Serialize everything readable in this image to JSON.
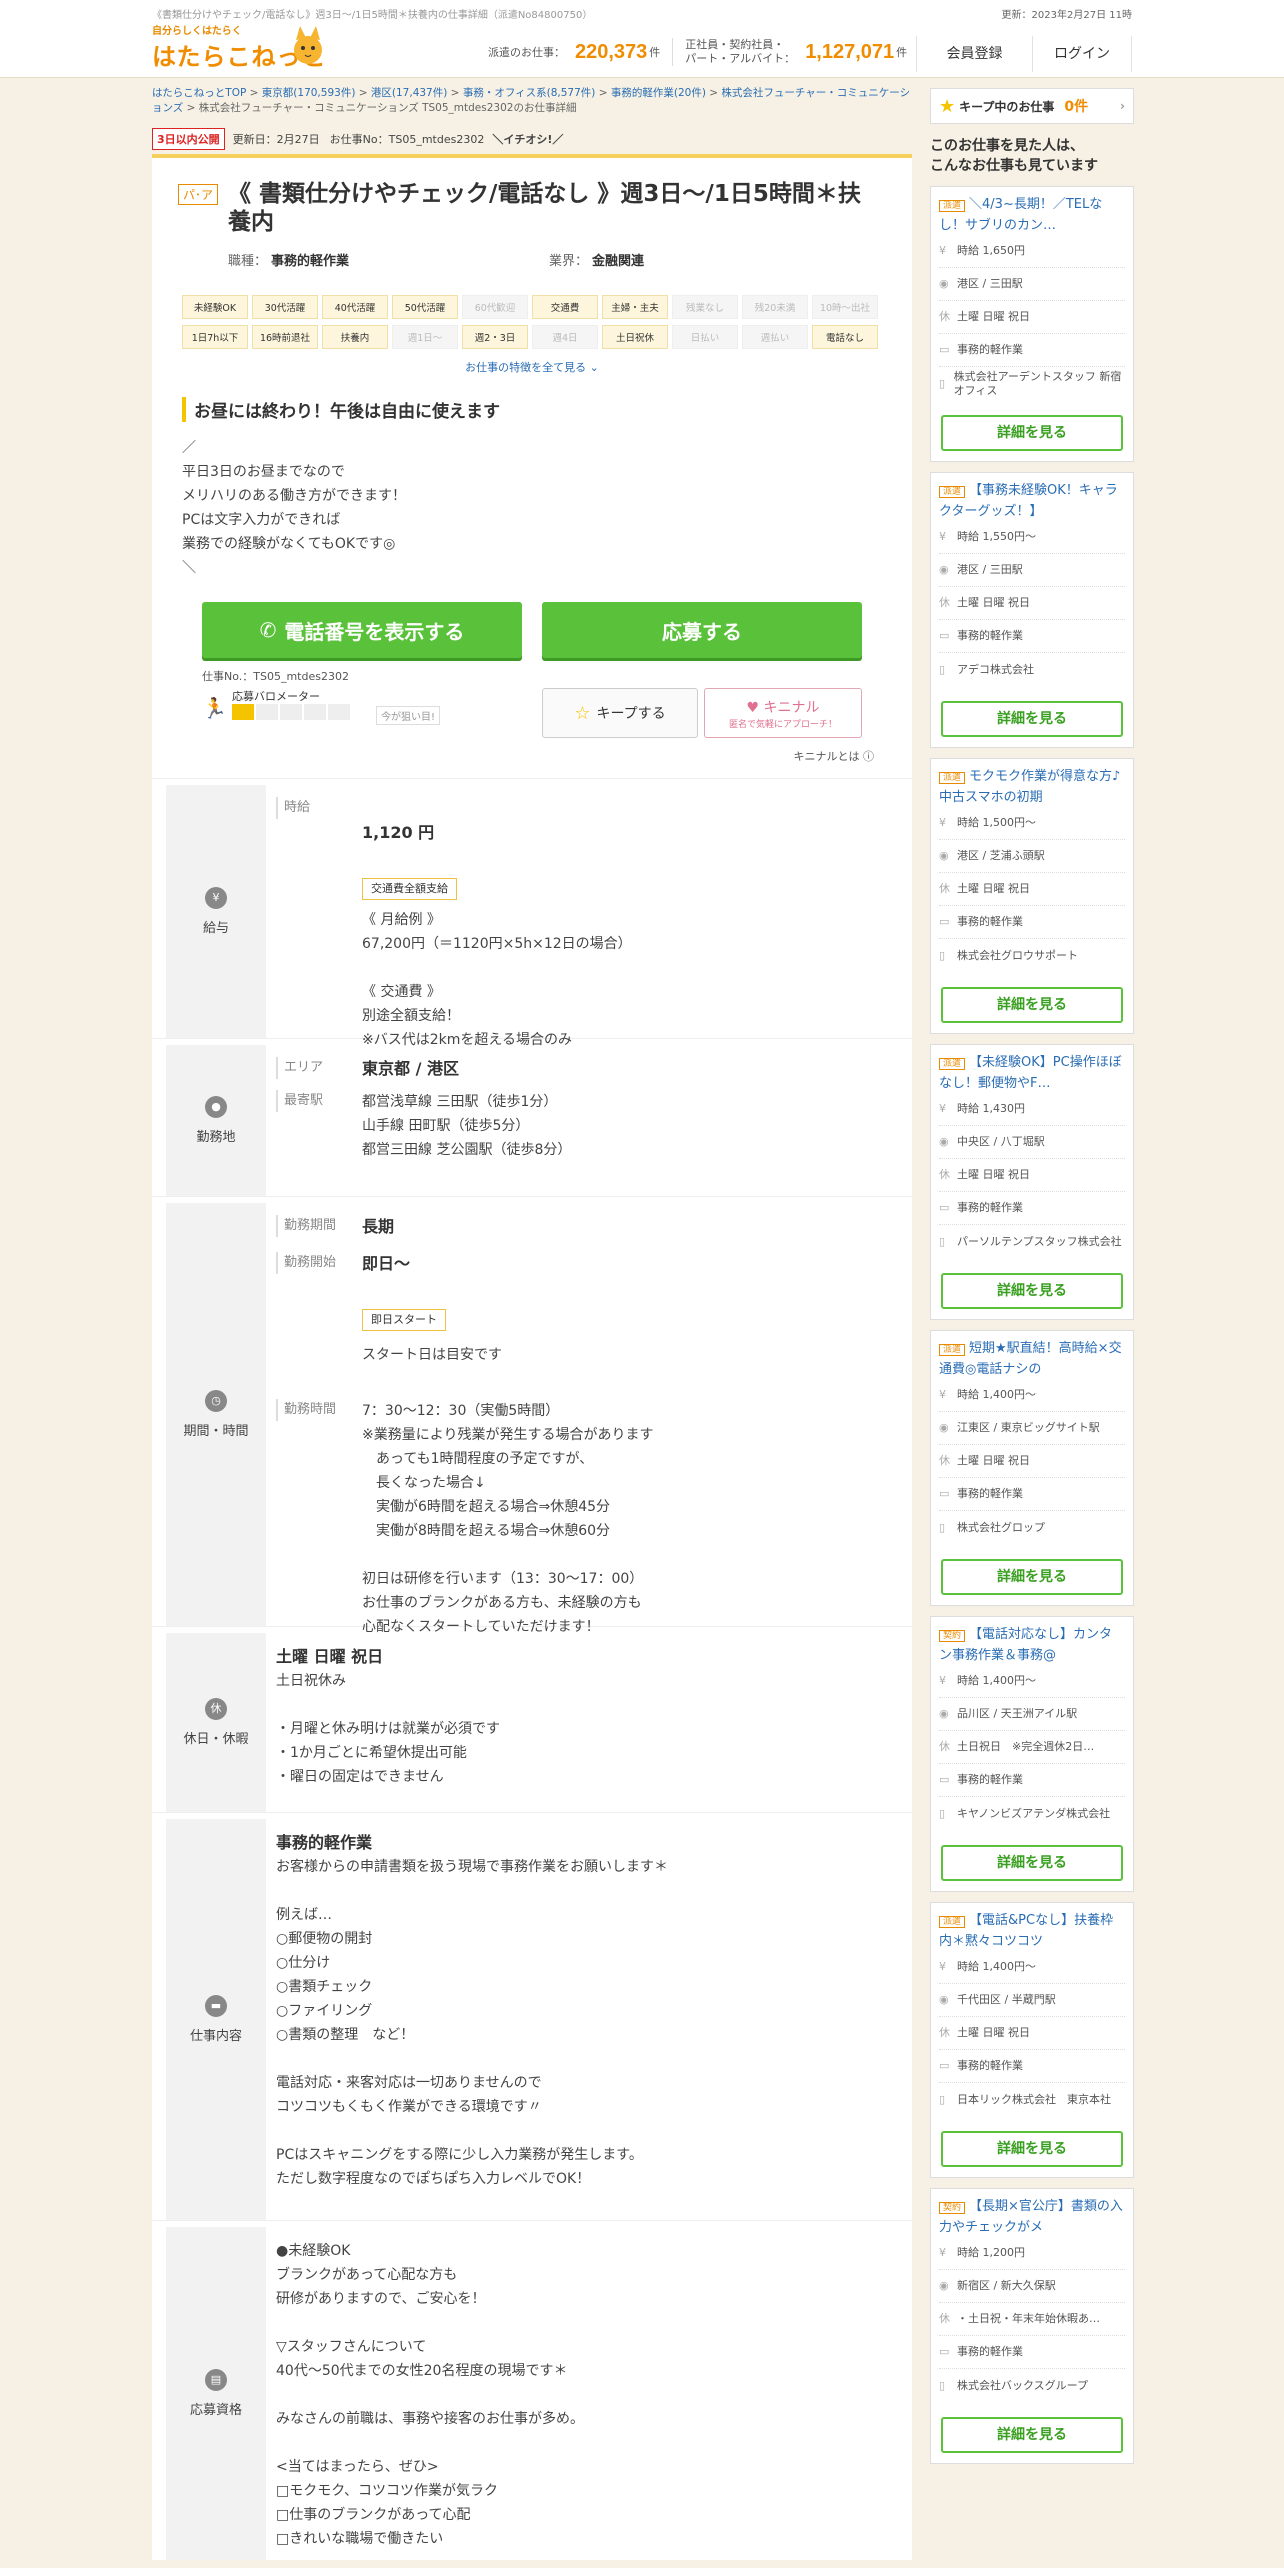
{
  "header": {
    "breadcrumb_top": "《書類仕分けやチェック/電話なし》週3日～/1日5時間＊扶養内の仕事詳細（派遣No84800750）",
    "updated": "更新：2023年2月27日 11時",
    "logo_small": "自分らしくはたらく",
    "logo_main": "はたらこねっと",
    "count1_label": "派遣のお仕事：",
    "count1_value": "220,373",
    "count1_unit": "件",
    "count2_label1": "正社員・契約社員・",
    "count2_label2": "パート・アルバイト：",
    "count2_value": "1,127,071",
    "count2_unit": "件",
    "register": "会員登録",
    "login": "ログイン"
  },
  "breadcrumb": [
    "はたらこねっとTOP",
    "東京都(170,593件)",
    "港区(17,437件)",
    "事務・オフィス系(8,577件)",
    "事務的軽作業(20件)",
    "株式会社フューチャー・コミュニケーションズ"
  ],
  "breadcrumb_last": "株式会社フューチャー・コミュニケーションズ TS05_mtdes2302のお仕事詳細",
  "job": {
    "new_badge": "3日以内公開",
    "updated": "更新日：2月27日",
    "job_no_label": "お仕事No：TS05_mtdes2302",
    "ichioshi": "＼イチオシ!／",
    "type_badge": "パ･ア",
    "title": "《 書類仕分けやチェック/電話なし 》週3日～/1日5時間＊扶養内",
    "occupation_key": "職種：",
    "occupation": "事務的軽作業",
    "industry_key": "業界：",
    "industry": "金融関連",
    "tags_row1": [
      {
        "t": "未経験OK",
        "on": true
      },
      {
        "t": "30代活躍",
        "on": true
      },
      {
        "t": "40代活躍",
        "on": true
      },
      {
        "t": "50代活躍",
        "on": true
      },
      {
        "t": "60代歓迎",
        "on": false
      },
      {
        "t": "交通費",
        "on": true
      },
      {
        "t": "主婦・主夫",
        "on": true
      },
      {
        "t": "残業なし",
        "on": false
      },
      {
        "t": "残20未満",
        "on": false
      },
      {
        "t": "10時～出社",
        "on": false
      }
    ],
    "tags_row2": [
      {
        "t": "1日7h以下",
        "on": true
      },
      {
        "t": "16時前退社",
        "on": true
      },
      {
        "t": "扶養内",
        "on": true
      },
      {
        "t": "週1日～",
        "on": false
      },
      {
        "t": "週2・3日",
        "on": true
      },
      {
        "t": "週4日",
        "on": false
      },
      {
        "t": "土日祝休",
        "on": true
      },
      {
        "t": "日払い",
        "on": false
      },
      {
        "t": "週払い",
        "on": false
      },
      {
        "t": "電話なし",
        "on": true
      }
    ],
    "more_features": "お仕事の特徴を全て見る",
    "catch": "お昼には終わり！午後は自由に使えます",
    "pr": "／\n平日3日のお昼までなので\nメリハリのある働き方ができます！\nPCは文字入力ができれば\n業務での経験がなくてもOKです◎\n＼",
    "phone_btn": "電話番号を表示する",
    "apply_btn": "応募する",
    "job_no": "仕事No.：TS05_mtdes2302",
    "barometer_label": "応募バロメーター",
    "barometer_hint": "今が狙い目!",
    "barometer_level": 1,
    "keep_btn": "キープする",
    "kinichi_btn": "キニナル",
    "kinichi_sub": "匿名で気軽にアプローチ！",
    "kinichi_about": "キニナルとは"
  },
  "salary": {
    "head": "給与",
    "type": "時給",
    "amount": "1,120 円",
    "chip": "交通費全額支給",
    "detail": "《 月給例 》\n67,200円（＝1120円×5h×12日の場合）\n\n《 交通費 》\n別途全額支給！\n※バス代は2kmを超える場合のみ"
  },
  "location": {
    "head": "勤務地",
    "area_label": "エリア",
    "area": "東京都 / 港区",
    "station_label": "最寄駅",
    "stations": "都営浅草線 三田駅（徒歩1分）\n山手線 田町駅（徒歩5分）\n都営三田線 芝公園駅（徒歩8分）"
  },
  "period": {
    "head": "期間・時間",
    "period_label": "勤務期間",
    "period": "長期",
    "start_label": "勤務開始",
    "start": "即日～",
    "start_chip": "即日スタート",
    "start_note": "スタート日は目安です",
    "time_label": "勤務時間",
    "time": "7：30～12：30（実働5時間）\n※業務量により残業が発生する場合があります\n　あっても1時間程度の予定ですが、\n　長くなった場合↓\n　実働が6時間を超える場合⇒休憩45分\n　実働が8時間を超える場合⇒休憩60分\n\n初日は研修を行います（13：30～17：00）\nお仕事のブランクがある方も、未経験の方も\n心配なくスタートしていただけます！"
  },
  "holiday": {
    "head": "休日・休暇",
    "title": "土曜 日曜 祝日",
    "detail": "土日祝休み\n\n・月曜と休み明けは就業が必須です\n・1か月ごとに希望休提出可能\n・曜日の固定はできません"
  },
  "work": {
    "head": "仕事内容",
    "title": "事務的軽作業",
    "detail": "お客様からの申請書類を扱う現場で事務作業をお願いします＊\n\n例えば…\n○郵便物の開封\n○仕分け\n○書類チェック\n○ファイリング\n○書類の整理　など！\n\n電話対応・来客対応は一切ありませんので\nコツコツもくもく作業ができる環境です〃\n\nPCはスキャニングをする際に少し入力業務が発生します。\nただし数字程度なのでぽちぽち入力レベルでOK！"
  },
  "qual": {
    "head": "応募資格",
    "detail": "●未経験OK\nブランクがあって心配な方も\n研修がありますので、ご安心を！\n\n▽スタッフさんについて\n40代～50代までの女性20名程度の現場です＊\n\nみなさんの前職は、事務や接客のお仕事が多め。\n\n<当てはまったら、ぜひ>\n□モクモク、コツコツ作業が気ラク\n□仕事のブランクがあって心配\n□きれいな職場で働きたい"
  },
  "sidebar": {
    "kept_label": "キープ中のお仕事",
    "kept_count": "0件",
    "heading": "このお仕事を見た人は、\nこんなお仕事も見ています",
    "detail_btn": "詳細を見る",
    "cards": [
      {
        "badge": "派遣",
        "title": "＼4/3~長期！／TELなし！サブリのカン…",
        "wage": "時給 1,650円",
        "area": "港区 / 三田駅",
        "holiday": "土曜 日曜 祝日",
        "job": "事務的軽作業",
        "company": "株式会社アーデントスタッフ 新宿オフィス"
      },
      {
        "badge": "派遣",
        "title": "【事務未経験OK！キャラクターグッズ！】",
        "wage": "時給 1,550円～",
        "area": "港区 / 三田駅",
        "holiday": "土曜 日曜 祝日",
        "job": "事務的軽作業",
        "company": "アデコ株式会社"
      },
      {
        "badge": "派遣",
        "title": "モクモク作業が得意な方♪中古スマホの初期",
        "wage": "時給 1,500円～",
        "area": "港区 / 芝浦ふ頭駅",
        "holiday": "土曜 日曜 祝日",
        "job": "事務的軽作業",
        "company": "株式会社グロウサポート"
      },
      {
        "badge": "派遣",
        "title": "【未経験OK】PC操作ほぼなし！郵便物やF…",
        "wage": "時給 1,430円",
        "area": "中央区 / 八丁堀駅",
        "holiday": "土曜 日曜 祝日",
        "job": "事務的軽作業",
        "company": "パーソルテンプスタッフ株式会社"
      },
      {
        "badge": "派遣",
        "title": "短期★駅直結！高時給×交通費◎電話ナシの",
        "wage": "時給 1,400円～",
        "area": "江東区 / 東京ビッグサイト駅",
        "holiday": "土曜 日曜 祝日",
        "job": "事務的軽作業",
        "company": "株式会社グロップ"
      },
      {
        "badge": "契約",
        "title": "【電話対応なし】カンタン事務作業＆事務@",
        "wage": "時給 1,400円～",
        "area": "品川区 / 天王洲アイル駅",
        "holiday": "土日祝日　※完全週休2日…",
        "job": "事務的軽作業",
        "company": "キヤノンビズアテンダ株式会社"
      },
      {
        "badge": "派遣",
        "title": "【電話&PCなし】扶養枠内＊黙々コツコツ",
        "wage": "時給 1,400円～",
        "area": "千代田区 / 半蔵門駅",
        "holiday": "土曜 日曜 祝日",
        "job": "事務的軽作業",
        "company": "日本リック株式会社　東京本社"
      },
      {
        "badge": "契約",
        "title": "【長期×官公庁】書類の入力やチェックがメ",
        "wage": "時給 1,200円",
        "area": "新宿区 / 新大久保駅",
        "holiday": "・土日祝・年末年始休暇あ…",
        "job": "事務的軽作業",
        "company": "株式会社バックスグループ"
      }
    ]
  }
}
